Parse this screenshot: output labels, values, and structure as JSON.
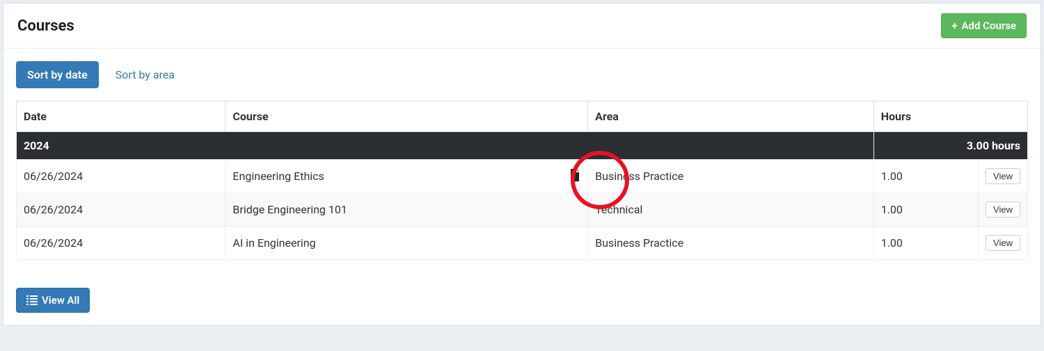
{
  "header": {
    "title": "Courses",
    "add_button": "Add Course"
  },
  "tabs": {
    "sort_by_date": "Sort by date",
    "sort_by_area": "Sort by area"
  },
  "table": {
    "columns": {
      "date": "Date",
      "course": "Course",
      "area": "Area",
      "hours": "Hours"
    },
    "year_group": {
      "year": "2024",
      "total": "3.00 hours"
    },
    "rows": [
      {
        "date": "06/26/2024",
        "course": "Engineering Ethics",
        "has_doc": true,
        "area": "Business Practice",
        "hours": "1.00",
        "action": "View"
      },
      {
        "date": "06/26/2024",
        "course": "Bridge Engineering 101",
        "has_doc": false,
        "area": "Technical",
        "hours": "1.00",
        "action": "View"
      },
      {
        "date": "06/26/2024",
        "course": "AI in Engineering",
        "has_doc": false,
        "area": "Business Practice",
        "hours": "1.00",
        "action": "View"
      }
    ]
  },
  "footer": {
    "view_all": "View All"
  }
}
